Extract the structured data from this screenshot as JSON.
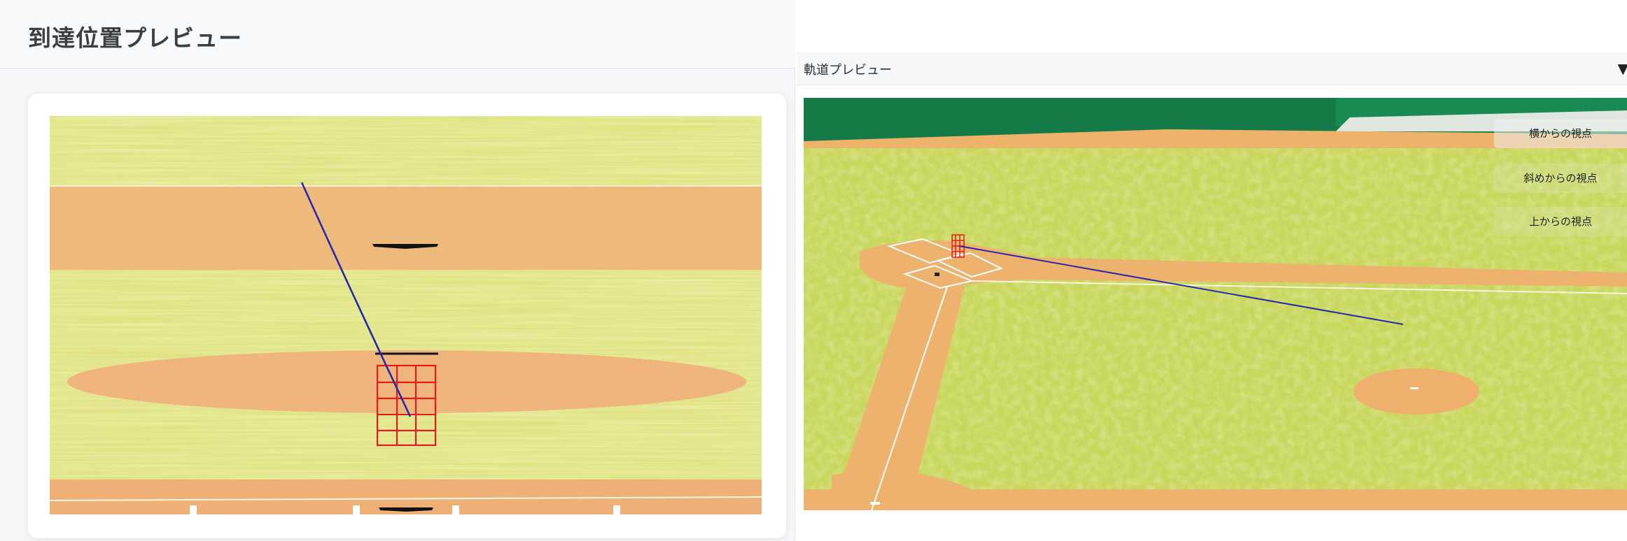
{
  "left_panel": {
    "title": "到達位置プレビュー"
  },
  "right_panel": {
    "title": "軌道プレビュー",
    "collapse_icon": "triangle-down-icon",
    "view_buttons": [
      {
        "label": "横からの視点"
      },
      {
        "label": "斜めからの視点"
      },
      {
        "label": "上からの視点"
      }
    ]
  },
  "colors": {
    "grass": "#d9e06f",
    "dirt": "#efb371",
    "strike_zone": "#e02020",
    "trajectory": "#2a2ab0",
    "stadium_wall": "#157a4a"
  }
}
